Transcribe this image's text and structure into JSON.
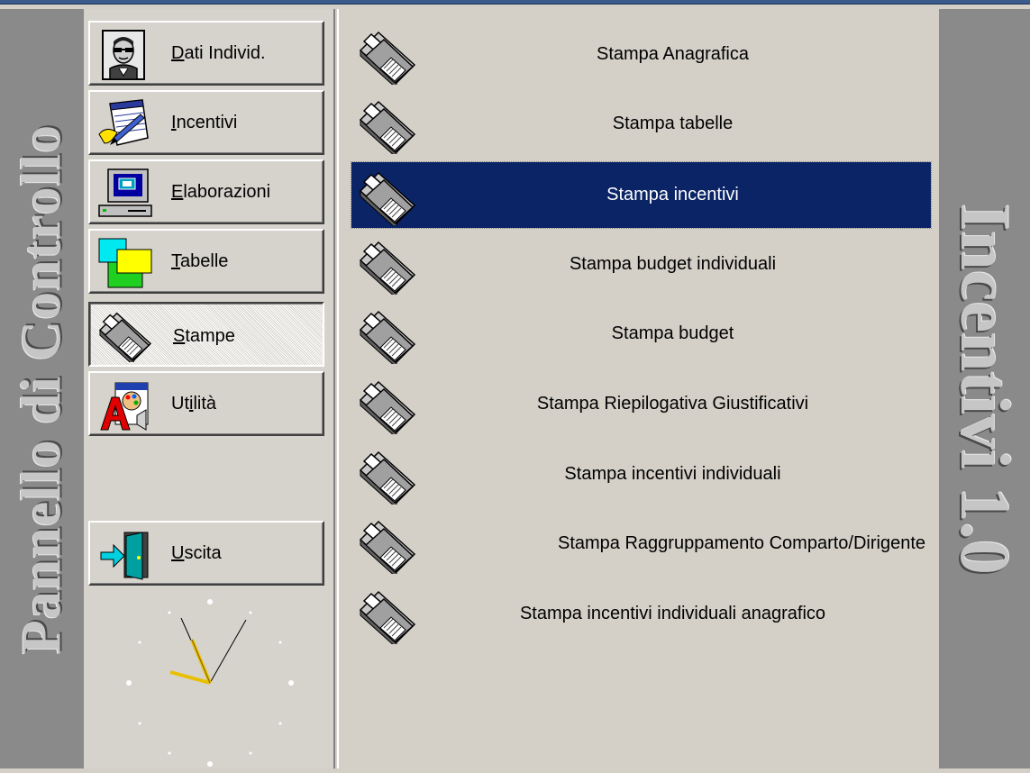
{
  "left_title": "Pannello di Controllo",
  "right_title": "Incentivi 1.0",
  "nav": {
    "dati": {
      "pre": "",
      "key": "D",
      "post": "ati Individ.",
      "icon": "person-sunglasses-icon"
    },
    "incentivi": {
      "pre": "",
      "key": "I",
      "post": "ncentivi",
      "icon": "notepad-pencil-icon"
    },
    "elaborazioni": {
      "pre": "",
      "key": "E",
      "post": "laborazioni",
      "icon": "computer-icon"
    },
    "tabelle": {
      "pre": "",
      "key": "T",
      "post": "abelle",
      "icon": "tables-icon"
    },
    "stampe": {
      "pre": "",
      "key": "S",
      "post": "tampe",
      "icon": "printer-icon",
      "pressed": true
    },
    "utilita": {
      "pre": "Ut",
      "key": "i",
      "post": "lità",
      "icon": "utilities-icon"
    },
    "uscita": {
      "pre": "",
      "key": "U",
      "post": "scita",
      "icon": "exit-door-icon"
    }
  },
  "print_items": [
    {
      "label": "Stampa Anagrafica"
    },
    {
      "label": "Stampa tabelle"
    },
    {
      "label": "Stampa incentivi",
      "selected": true
    },
    {
      "label": "Stampa budget individuali"
    },
    {
      "label": "Stampa budget"
    },
    {
      "label": "Stampa Riepilogativa Giustificativi"
    },
    {
      "label": "Stampa incentivi individuali"
    },
    {
      "label": "Stampa Raggruppamento Comparto/Dirigente"
    },
    {
      "label": "Stampa incentivi individuali anagrafico"
    }
  ],
  "colors": {
    "selection": "#0a2466",
    "panel_gray": "#8a8a8a",
    "face": "#d4d0c8",
    "clock_hands": "#e8c000"
  },
  "clock": {
    "icon": "analog-clock-icon"
  }
}
